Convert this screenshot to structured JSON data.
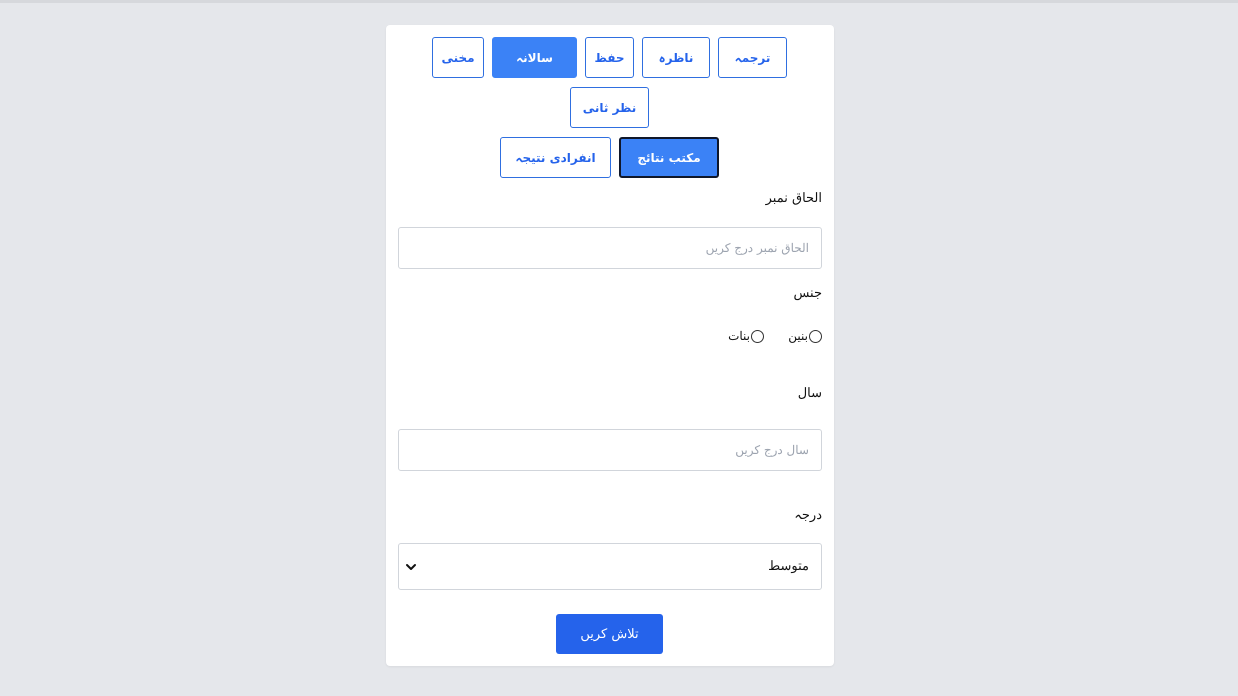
{
  "tabs": [
    {
      "label": "ترجمہ",
      "state": "default"
    },
    {
      "label": "ناظرہ",
      "state": "default"
    },
    {
      "label": "حفظ",
      "state": "default"
    },
    {
      "label": "سالانہ",
      "state": "active"
    },
    {
      "label": "مخنی",
      "state": "default"
    },
    {
      "label": "نظر ثانی",
      "state": "default"
    }
  ],
  "result_tabs": [
    {
      "label": "مکتب نتائج",
      "state": "selected"
    },
    {
      "label": "انفرادی نتیجہ",
      "state": "default"
    }
  ],
  "form": {
    "admission_label": "الحاق نمبر",
    "admission_placeholder": "الحاق نمبر درج کریں",
    "gender_label": "جنس",
    "gender_options": [
      "بنین",
      "بنات"
    ],
    "year_label": "سال",
    "year_placeholder": "سال درج کریں",
    "level_label": "درجہ",
    "level_value": "متوسط",
    "search_button": "تلاش کریں"
  }
}
